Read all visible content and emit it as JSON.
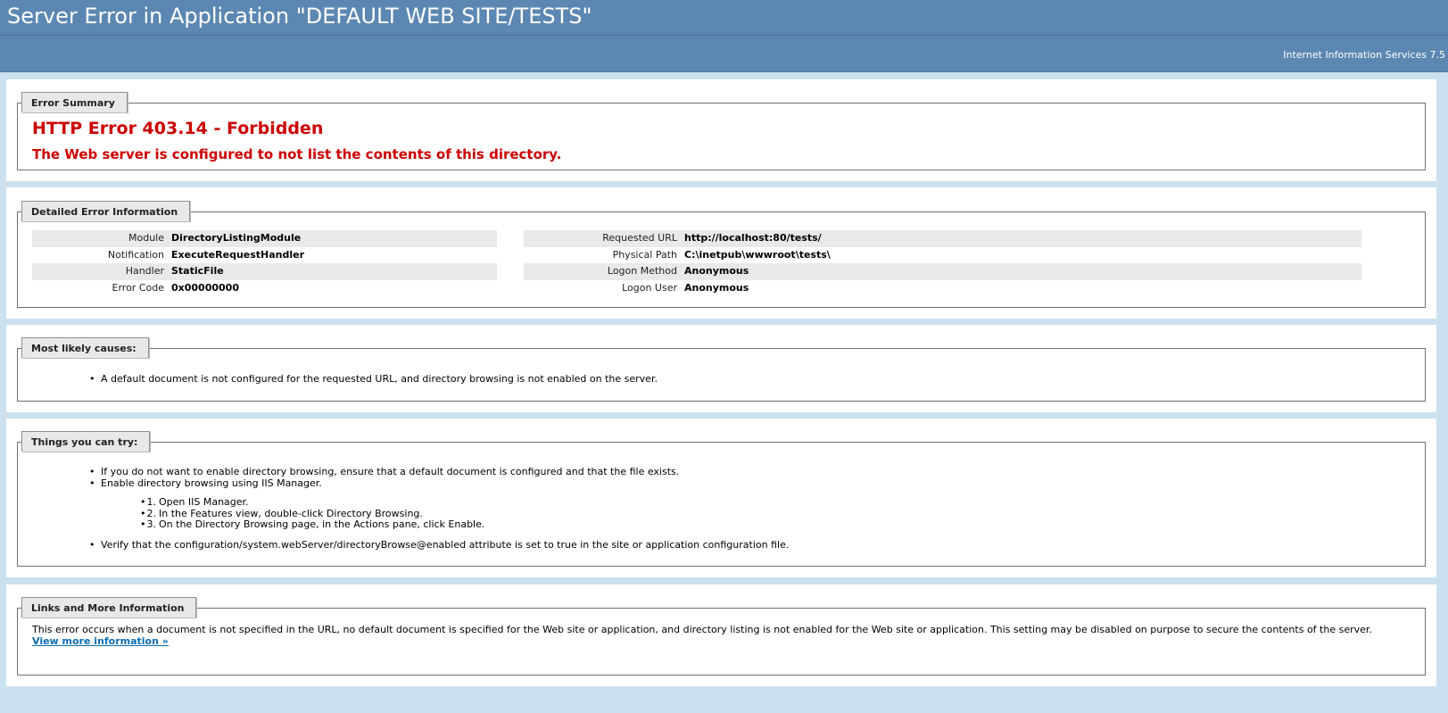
{
  "header": {
    "title": "Server Error in Application \"DEFAULT WEB SITE/TESTS\"",
    "product": "Internet Information Services 7.5"
  },
  "summary": {
    "legend": "Error Summary",
    "title": "HTTP Error 403.14 - Forbidden",
    "message": "The Web server is configured to not list the contents of this directory."
  },
  "details": {
    "legend": "Detailed Error Information",
    "left": [
      {
        "label": "Module",
        "value": "DirectoryListingModule"
      },
      {
        "label": "Notification",
        "value": "ExecuteRequestHandler"
      },
      {
        "label": "Handler",
        "value": "StaticFile"
      },
      {
        "label": "Error Code",
        "value": "0x00000000"
      }
    ],
    "right": [
      {
        "label": "Requested URL",
        "value": "http://localhost:80/tests/"
      },
      {
        "label": "Physical Path",
        "value": "C:\\inetpub\\wwwroot\\tests\\"
      },
      {
        "label": "Logon Method",
        "value": "Anonymous"
      },
      {
        "label": "Logon User",
        "value": "Anonymous"
      }
    ]
  },
  "causes": {
    "legend": "Most likely causes:",
    "items": [
      "A default document is not configured for the requested URL, and directory browsing is not enabled on the server."
    ]
  },
  "try": {
    "legend": "Things you can try:",
    "item1": "If you do not want to enable directory browsing, ensure that a default document is configured and that the file exists.",
    "item2": "Enable directory browsing using IIS Manager.",
    "steps": [
      {
        "num": "1.",
        "text": "Open IIS Manager."
      },
      {
        "num": "2.",
        "text": "In the Features view, double-click Directory Browsing."
      },
      {
        "num": "3.",
        "text": "On the Directory Browsing page, in the Actions pane, click Enable."
      }
    ],
    "item3": "Verify that the configuration/system.webServer/directoryBrowse@enabled attribute is set to true in the site or application configuration file."
  },
  "links": {
    "legend": "Links and More Information",
    "text": "This error occurs when a document is not specified in the URL, no default document is specified for the Web site or application, and directory listing is not enabled for the Web site or application. This setting may be disabled on purpose to secure the contents of the server.",
    "link_label": "View more information »"
  },
  "colors": {
    "header_bg": "#5C87B2",
    "page_bg": "#CBE1EF",
    "error_red": "#CC0000",
    "link_blue": "#0B6DB5"
  }
}
